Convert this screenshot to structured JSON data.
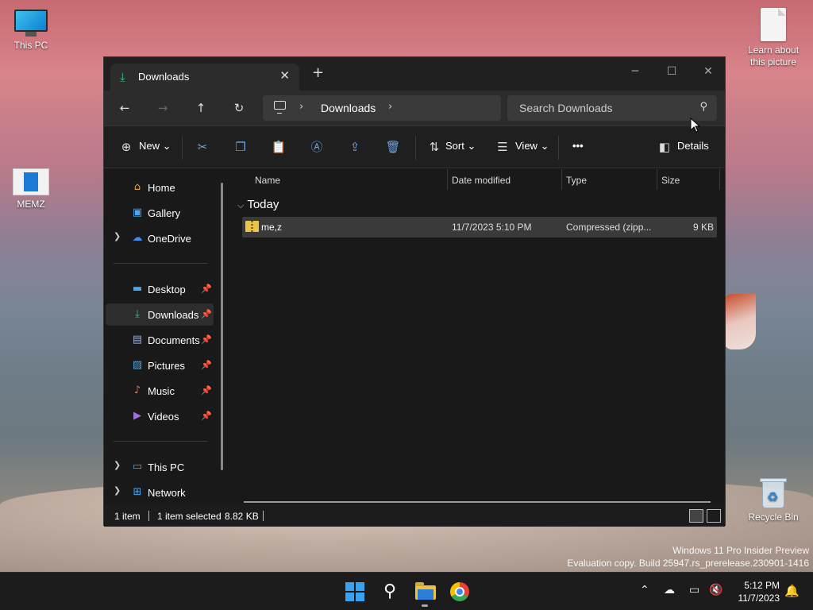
{
  "desktop": {
    "icons": [
      {
        "label": "This PC"
      },
      {
        "label": "MEMZ"
      },
      {
        "label": "Learn about this picture"
      },
      {
        "label": "Recycle Bin"
      }
    ],
    "watermark": {
      "line1": "Windows 11 Pro Insider Preview",
      "line2": "Evaluation copy. Build 25947.rs_prerelease.230901-1416"
    }
  },
  "window": {
    "tab_title": "Downloads",
    "nav": {
      "breadcrumb": "Downloads",
      "search_placeholder": "Search Downloads"
    },
    "toolbar": {
      "new_label": "New",
      "sort_label": "Sort",
      "view_label": "View",
      "more_label": "•••",
      "details_label": "Details"
    },
    "sidebar": {
      "items": [
        {
          "label": "Home"
        },
        {
          "label": "Gallery"
        },
        {
          "label": "OneDrive"
        },
        {
          "label": "Desktop"
        },
        {
          "label": "Downloads"
        },
        {
          "label": "Documents"
        },
        {
          "label": "Pictures"
        },
        {
          "label": "Music"
        },
        {
          "label": "Videos"
        },
        {
          "label": "This PC"
        },
        {
          "label": "Network"
        }
      ]
    },
    "columns": [
      "Name",
      "Date modified",
      "Type",
      "Size"
    ],
    "group_label": "Today",
    "files": [
      {
        "name": "me,z",
        "date": "11/7/2023 5:10 PM",
        "type": "Compressed (zipp...",
        "size": "9 KB"
      }
    ],
    "status": {
      "count": "1 item",
      "selected": "1 item selected",
      "selected_size": "8.82 KB"
    }
  },
  "taskbar": {
    "time": "5:12 PM",
    "date": "11/7/2023"
  },
  "colors": {
    "accent": "#6ba4e8",
    "download_green": "#33c481",
    "window_bg": "#191919"
  }
}
